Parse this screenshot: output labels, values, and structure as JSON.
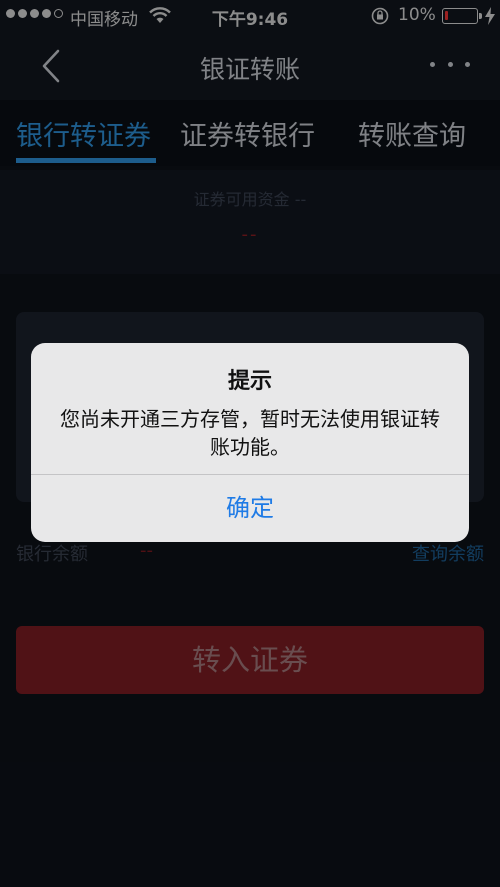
{
  "status_bar": {
    "carrier": "中国移动",
    "time": "下午9:46",
    "battery_percent": "10%",
    "battery_level": 0.1,
    "signal_bars_filled": 4,
    "signal_bars_total": 5
  },
  "nav": {
    "title": "银证转账",
    "back_icon": "chevron-left-icon",
    "more_icon": "more-dots-icon"
  },
  "tabs": [
    {
      "label": "银行转证券",
      "active": true
    },
    {
      "label": "证券转银行",
      "active": false
    },
    {
      "label": "转账查询",
      "active": false
    }
  ],
  "funds": {
    "label": "证券可用资金 --",
    "value": "--"
  },
  "bank_balance": {
    "label": "银行余额",
    "value": "--",
    "query_link": "查询余额"
  },
  "submit_button": "转入证券",
  "alert": {
    "title": "提示",
    "message": "您尚未开通三方存管，暂时无法使用银证转账功能。",
    "confirm": "确定"
  },
  "colors": {
    "accent": "#2d8fd8",
    "submit": "#7c1d23",
    "alert_link": "#1f7be6",
    "background": "#0d1118"
  }
}
